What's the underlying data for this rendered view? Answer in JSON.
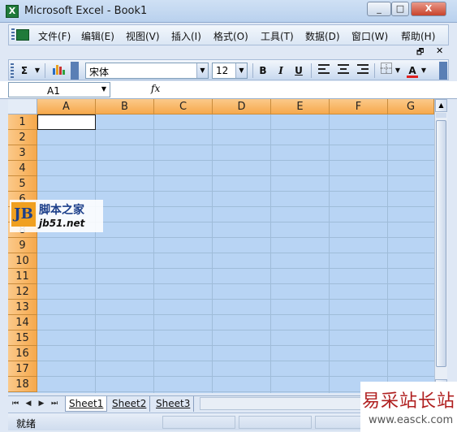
{
  "window": {
    "title": "Microsoft Excel - Book1",
    "app_icon": "excel-icon",
    "controls": {
      "minimize": "_",
      "maximize": "□",
      "close": "X"
    }
  },
  "menu": {
    "items": [
      "文件(F)",
      "编辑(E)",
      "视图(V)",
      "插入(I)",
      "格式(O)",
      "工具(T)",
      "数据(D)",
      "窗口(W)",
      "帮助(H)"
    ],
    "doc_restore": "🗗",
    "doc_close": "✕"
  },
  "toolbar": {
    "autosum": "Σ",
    "font_name": "宋体",
    "font_size": "12",
    "bold": "B",
    "italic": "I",
    "underline": "U",
    "font_color_label": "A",
    "font_color": "#e02020"
  },
  "formula_bar": {
    "name_box": "A1",
    "fx_label": "fx",
    "value": ""
  },
  "grid": {
    "columns": [
      "A",
      "B",
      "C",
      "D",
      "E",
      "F",
      "G"
    ],
    "rows": [
      "1",
      "2",
      "3",
      "4",
      "5",
      "6",
      "7",
      "8",
      "9",
      "10",
      "11",
      "12",
      "13",
      "14",
      "15",
      "16",
      "17",
      "18"
    ],
    "active_cell": "A1",
    "selection_color": "#b8d4f4",
    "header_color": "#f6a94c"
  },
  "sheets": {
    "tabs": [
      "Sheet1",
      "Sheet2",
      "Sheet3"
    ],
    "nav": [
      "⏮",
      "◀",
      "▶",
      "⏭"
    ]
  },
  "status": {
    "text": "就绪"
  },
  "watermarks": {
    "site1_logo": "JB",
    "site1_name": "脚本之家",
    "site1_url": "jb51.net",
    "site2_name": "易采站长站",
    "site2_url": "www.easck.com"
  }
}
